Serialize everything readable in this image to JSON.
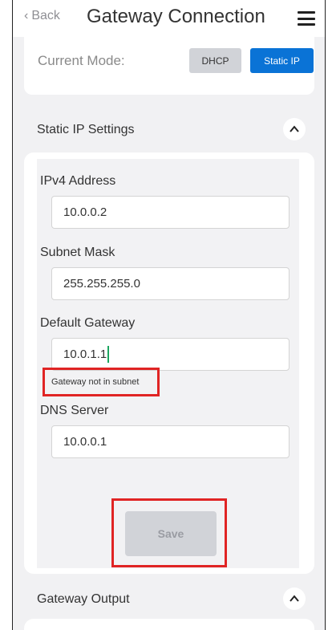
{
  "header": {
    "back_label": "Back",
    "title": "Gateway Connection"
  },
  "mode": {
    "label": "Current Mode:",
    "options": [
      "DHCP",
      "Static IP"
    ],
    "selected": "Static IP"
  },
  "static_ip": {
    "section_label": "Static IP Settings",
    "fields": [
      {
        "label": "IPv4 Address",
        "value": "10.0.0.2"
      },
      {
        "label": "Subnet Mask",
        "value": "255.255.255.0"
      },
      {
        "label": "Default Gateway",
        "value": "10.0.1.1"
      },
      {
        "label": "DNS Server",
        "value": "10.0.0.1"
      }
    ],
    "error": "Gateway not in subnet",
    "save_label": "Save"
  },
  "gateway_output": {
    "section_label": "Gateway Output"
  },
  "colors": {
    "accent": "#0a73d6",
    "error_highlight": "#e02424",
    "cursor": "#1aa55f"
  },
  "icons": {
    "back": "chevron-left-icon",
    "menu": "hamburger-menu-icon",
    "collapse": "chevron-up-icon"
  }
}
